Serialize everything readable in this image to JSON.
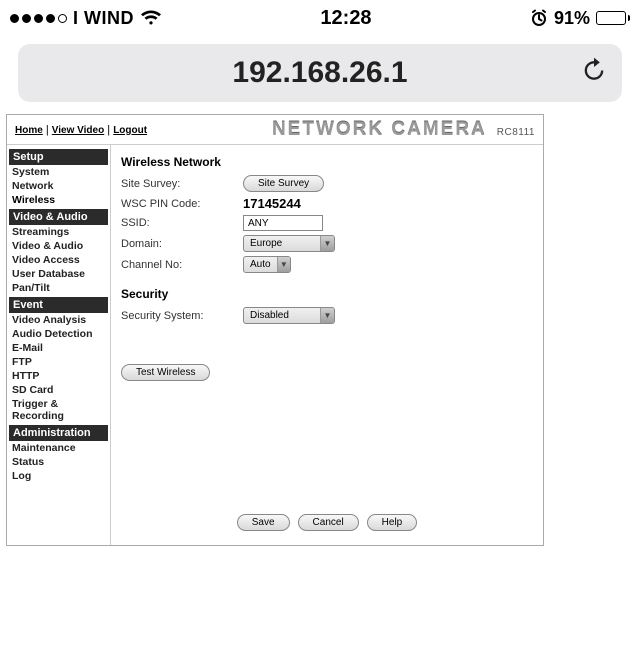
{
  "status": {
    "carrier": "I WIND",
    "time": "12:28",
    "battery_pct": "91%",
    "battery_fill_pct": 91
  },
  "browser": {
    "url": "192.168.26.1"
  },
  "page": {
    "top_links": {
      "home": "Home",
      "view_video": "View Video",
      "logout": "Logout",
      "sep": " | "
    },
    "title": "NETWORK CAMERA",
    "model": "RC8111"
  },
  "sidebar": {
    "setup": {
      "cat": "Setup",
      "items": [
        "System",
        "Network",
        "Wireless"
      ]
    },
    "va": {
      "cat": "Video & Audio",
      "items": [
        "Streamings",
        "Video & Audio",
        "Video Access",
        "User Database",
        "Pan/Tilt"
      ]
    },
    "event": {
      "cat": "Event",
      "items": [
        "Video Analysis",
        "Audio Detection",
        "E-Mail",
        "FTP",
        "HTTP",
        "SD Card",
        "Trigger & Recording"
      ]
    },
    "admin": {
      "cat": "Administration",
      "items": [
        "Maintenance",
        "Status",
        "Log"
      ]
    }
  },
  "main": {
    "section_wireless": "Wireless Network",
    "labels": {
      "site_survey": "Site Survey:",
      "wsc_pin": "WSC PIN Code:",
      "ssid": "SSID:",
      "domain": "Domain:",
      "channel": "Channel No:"
    },
    "values": {
      "site_survey_btn": "Site Survey",
      "wsc_pin": "17145244",
      "ssid": "ANY",
      "domain_sel": "Europe",
      "channel_sel": "Auto"
    },
    "section_security": "Security",
    "security_label": "Security System:",
    "security_value": "Disabled",
    "test_btn": "Test Wireless",
    "footer": {
      "save": "Save",
      "cancel": "Cancel",
      "help": "Help"
    }
  }
}
